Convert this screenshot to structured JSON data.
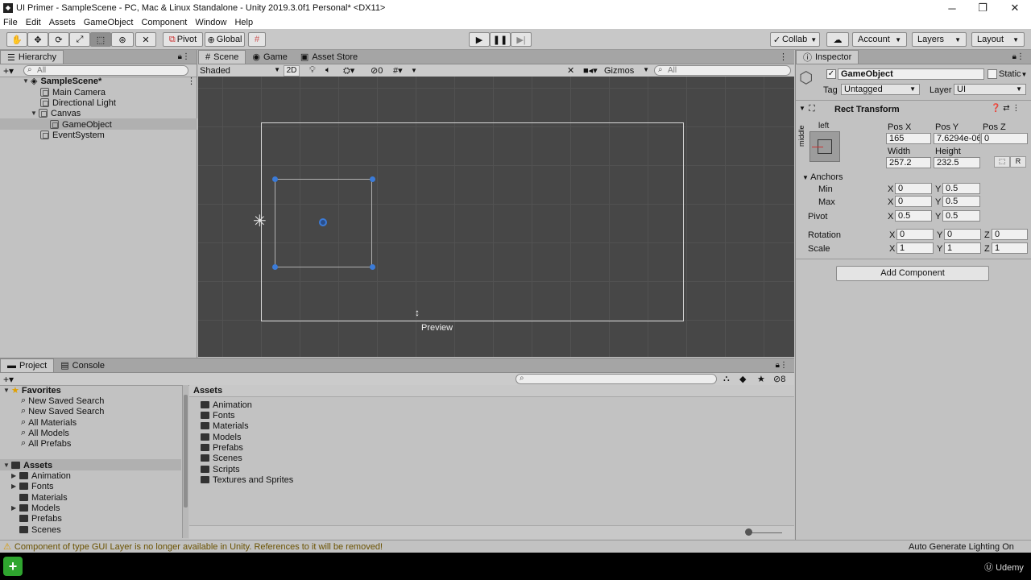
{
  "window": {
    "title": "UI Primer - SampleScene - PC, Mac & Linux Standalone - Unity 2019.3.0f1 Personal* <DX11>"
  },
  "menu": [
    "File",
    "Edit",
    "Assets",
    "GameObject",
    "Component",
    "Window",
    "Help"
  ],
  "toolbar": {
    "pivot_label": "Pivot",
    "global_label": "Global",
    "collab_label": "Collab",
    "account_label": "Account",
    "layers_label": "Layers",
    "layout_label": "Layout"
  },
  "hierarchy": {
    "tab": "Hierarchy",
    "search_placeholder": "All",
    "items": [
      {
        "label": "SampleScene*"
      },
      {
        "label": "Main Camera"
      },
      {
        "label": "Directional Light"
      },
      {
        "label": "Canvas"
      },
      {
        "label": "GameObject"
      },
      {
        "label": "EventSystem"
      }
    ]
  },
  "scene": {
    "tabs": [
      "Scene",
      "Game",
      "Asset Store"
    ],
    "shading": "Shaded",
    "mode_2d": "2D",
    "fx_count": "0",
    "gizmos_label": "Gizmos",
    "search_placeholder": "All",
    "preview_label": "Preview"
  },
  "inspector": {
    "tab": "Inspector",
    "object_name": "GameObject",
    "static_label": "Static",
    "tag_label": "Tag",
    "tag_value": "Untagged",
    "layer_label": "Layer",
    "layer_value": "UI",
    "component_title": "Rect Transform",
    "anchor_preset_top": "left",
    "anchor_preset_side": "middle",
    "pos_x_label": "Pos X",
    "pos_x": "165",
    "pos_y_label": "Pos Y",
    "pos_y": "7.6294e-06",
    "pos_z_label": "Pos Z",
    "pos_z": "0",
    "width_label": "Width",
    "width": "257.2",
    "height_label": "Height",
    "height": "232.5",
    "r_button": "R",
    "anchors_label": "Anchors",
    "min_label": "Min",
    "min_x": "0",
    "min_y": "0.5",
    "max_label": "Max",
    "max_x": "0",
    "max_y": "0.5",
    "pivot_label": "Pivot",
    "pivot_x": "0.5",
    "pivot_y": "0.5",
    "rotation_label": "Rotation",
    "rot_x": "0",
    "rot_y": "0",
    "rot_z": "0",
    "scale_label": "Scale",
    "scale_x": "1",
    "scale_y": "1",
    "scale_z": "1",
    "x": "X",
    "y": "Y",
    "z": "Z",
    "add_component": "Add Component"
  },
  "project": {
    "tabs": [
      "Project",
      "Console"
    ],
    "hidden_count": "8",
    "favorites_label": "Favorites",
    "favorites": [
      "New Saved Search",
      "New Saved Search",
      "All Materials",
      "All Models",
      "All Prefabs"
    ],
    "assets_label": "Assets",
    "tree_assets": [
      "Animation",
      "Fonts",
      "Materials",
      "Models",
      "Prefabs",
      "Scenes"
    ],
    "content_header": "Assets",
    "content_items": [
      "Animation",
      "Fonts",
      "Materials",
      "Models",
      "Prefabs",
      "Scenes",
      "Scripts",
      "Textures and Sprites"
    ]
  },
  "status": {
    "warning": "Component of type GUI Layer is no longer available in Unity. References to it will be removed!",
    "lighting": "Auto Generate Lighting On"
  },
  "watermark": "Udemy"
}
